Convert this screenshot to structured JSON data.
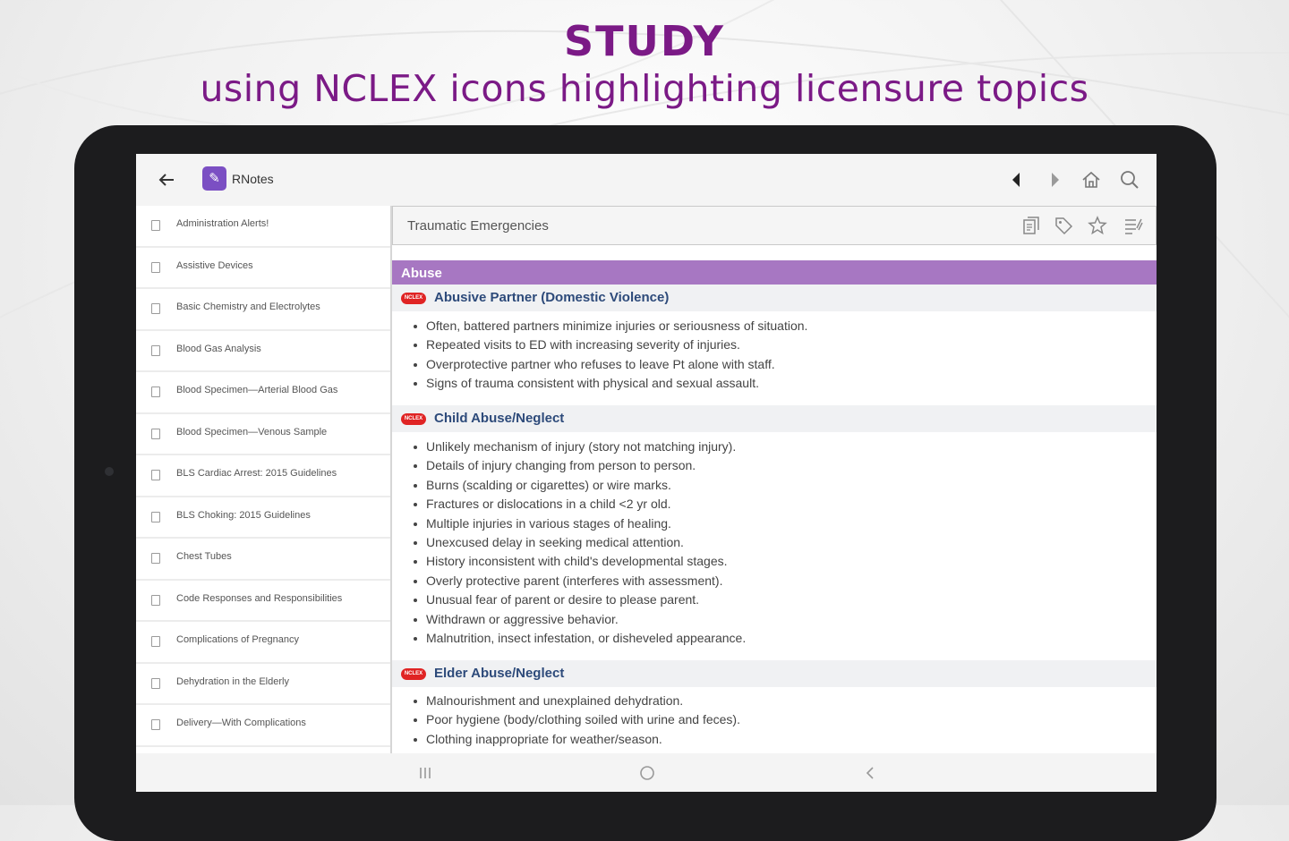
{
  "headline": {
    "line1": "STUDY",
    "line2": "using NCLEX icons highlighting licensure topics"
  },
  "appbar": {
    "title": "RNotes",
    "icons": [
      "back-arrow-icon",
      "prev-triangle-icon",
      "next-triangle-icon",
      "home-icon",
      "search-icon"
    ]
  },
  "sidebar": {
    "items": [
      {
        "label": "Administration Alerts!"
      },
      {
        "label": "Assistive Devices"
      },
      {
        "label": "Basic Chemistry and Electrolytes"
      },
      {
        "label": "Blood Gas Analysis"
      },
      {
        "label": "Blood Specimen—Arterial Blood Gas"
      },
      {
        "label": "Blood Specimen—Venous Sample"
      },
      {
        "label": "BLS Cardiac Arrest: 2015 Guidelines"
      },
      {
        "label": "BLS Choking: 2015 Guidelines"
      },
      {
        "label": "Chest Tubes"
      },
      {
        "label": "Code Responses and Responsibilities"
      },
      {
        "label": "Complications of Pregnancy"
      },
      {
        "label": "Dehydration in the Elderly"
      },
      {
        "label": "Delivery—With Complications"
      }
    ]
  },
  "content": {
    "topic": "Traumatic Emergencies",
    "toolbar_icons": [
      "notes-icon",
      "tag-icon",
      "star-icon",
      "list-icon"
    ],
    "section": "Abuse",
    "nclex_badge": "NCLEX",
    "subsections": [
      {
        "title": "Abusive Partner (Domestic Violence)",
        "bullets": [
          "Often, battered partners minimize injuries or seriousness of situation.",
          "Repeated visits to ED with increasing severity of injuries.",
          "Overprotective partner who refuses to leave Pt alone with staff.",
          "Signs of trauma consistent with physical and sexual assault."
        ]
      },
      {
        "title": "Child Abuse/Neglect",
        "bullets": [
          "Unlikely mechanism of injury (story not matching injury).",
          "Details of injury changing from person to person.",
          "Burns (scalding or cigarettes) or wire marks.",
          "Fractures or dislocations in a child <2 yr old.",
          "Multiple injuries in various stages of healing.",
          "Unexcused delay in seeking medical attention.",
          "History inconsistent with child's developmental stages.",
          "Overly protective parent (interferes with assessment).",
          "Unusual fear of parent or desire to please parent.",
          "Withdrawn or aggressive behavior.",
          "Malnutrition, insect infestation, or disheveled appearance."
        ]
      },
      {
        "title": "Elder Abuse/Neglect",
        "bullets": [
          "Malnourishment and unexplained dehydration.",
          "Poor hygiene (body/clothing soiled with urine and feces).",
          "Clothing inappropriate for weather/season."
        ]
      }
    ]
  },
  "colors": {
    "headline": "#7b1a86",
    "section_header": "#a777c2",
    "subsection_title": "#2d4a7a",
    "nclex_badge": "#e02424"
  }
}
